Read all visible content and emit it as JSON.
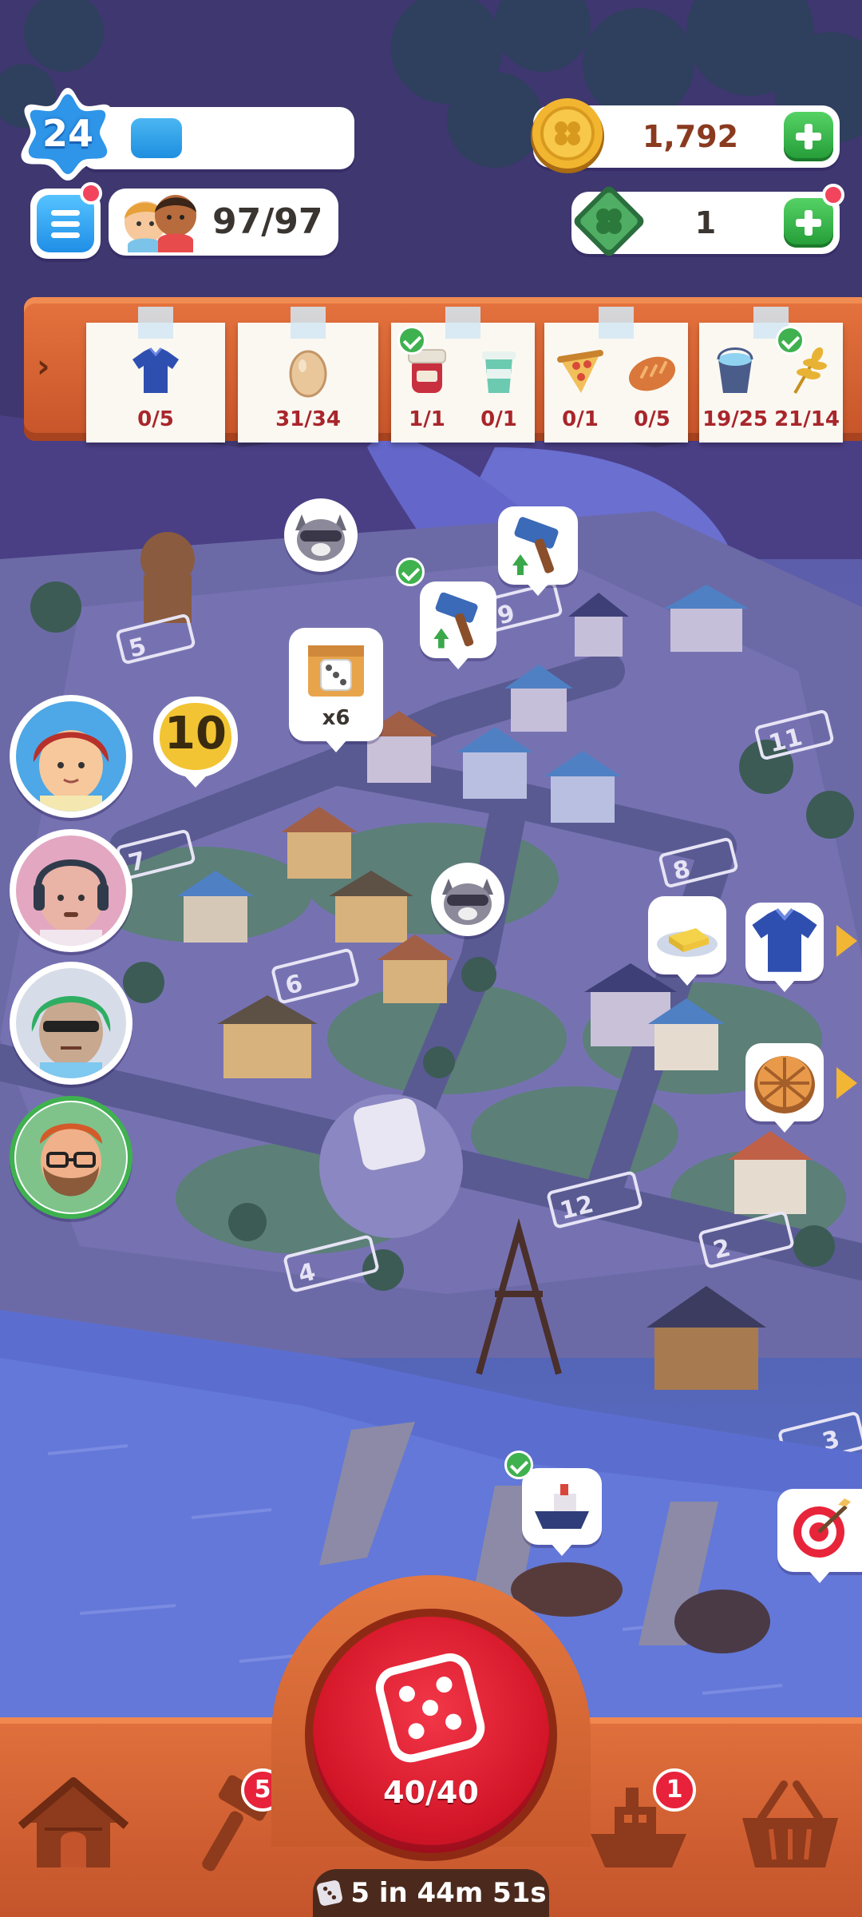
{
  "hud": {
    "level": "24",
    "xp_progress": 0.24,
    "population": "97/97",
    "coins": "1,792",
    "cash": "1"
  },
  "quest_board": {
    "notes": [
      {
        "items": [
          {
            "icon": "shirt-icon",
            "count": "0/5",
            "done": false
          }
        ]
      },
      {
        "items": [
          {
            "icon": "egg-icon",
            "count": "31/34",
            "done": false
          }
        ]
      },
      {
        "items": [
          {
            "icon": "jam-jar-icon",
            "count": "1/1",
            "done": true
          },
          {
            "icon": "cup-icon",
            "count": "0/1",
            "done": false
          }
        ]
      },
      {
        "items": [
          {
            "icon": "pizza-icon",
            "count": "0/1",
            "done": false
          },
          {
            "icon": "bread-icon",
            "count": "0/5",
            "done": false
          }
        ]
      },
      {
        "items": [
          {
            "icon": "water-bucket-icon",
            "count": "19/25",
            "done": false
          },
          {
            "icon": "wheat-icon",
            "count": "21/14",
            "done": true
          }
        ]
      }
    ]
  },
  "map": {
    "dice_reward_label": "x6",
    "visitor_badge": "10"
  },
  "bottom": {
    "roll_count": "40/40",
    "timer": "5 in 44m 51s",
    "build_badge": "5",
    "ship_badge": "1"
  },
  "colors": {
    "accent_blue": "#1e8fe0",
    "roll_red": "#d31528",
    "wood_orange": "#d2602f",
    "plus_green": "#239b37"
  }
}
